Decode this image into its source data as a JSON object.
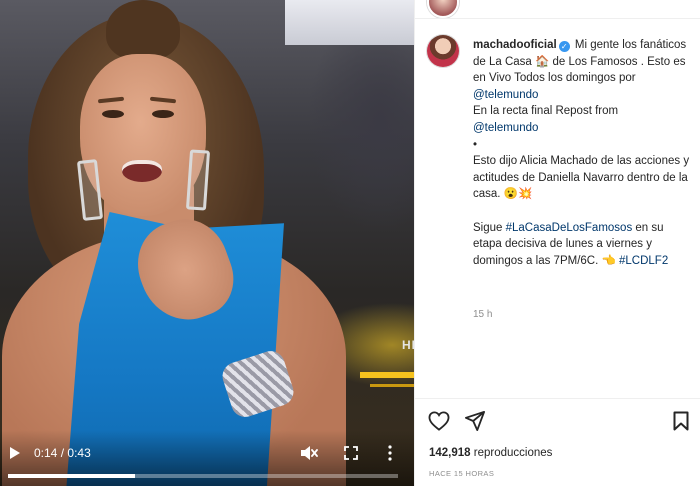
{
  "video": {
    "current_time": "0:14",
    "duration": "0:43",
    "time_separator": "/",
    "progress": 0.3256,
    "muted": true
  },
  "post": {
    "username": "machadooficial",
    "verified": true,
    "caption_lines": [
      "Mi gente los fanáticos de La Casa 🏠 de Los Famosos . Esto es en Vivo Todos los domingos por",
      "@telemundo",
      "En la recta final Repost from",
      "@telemundo",
      "•",
      "Esto dijo Alicia Machado de las acciones y actitudes de Daniella Navarro dentro de la casa. 😮💥",
      "Sigue",
      "#LaCasaDeLosFamosos",
      "en su etapa decisiva de lunes a viernes y domingos a las 7PM/6C. 👈",
      "#LCDLF2"
    ],
    "time_ago": "15 h",
    "views_count": "142,918",
    "views_label": "reproducciones",
    "timestamp": "HACE 15 HORAS"
  },
  "colors": {
    "link": "#00376b",
    "verified": "#3897f0",
    "dress": "#1f8ed8"
  },
  "icons": {
    "play": "play-icon",
    "mute": "speaker-muted-icon",
    "fullscreen": "fullscreen-icon",
    "more": "more-icon",
    "like": "heart-icon",
    "share": "share-icon",
    "save": "bookmark-icon"
  }
}
